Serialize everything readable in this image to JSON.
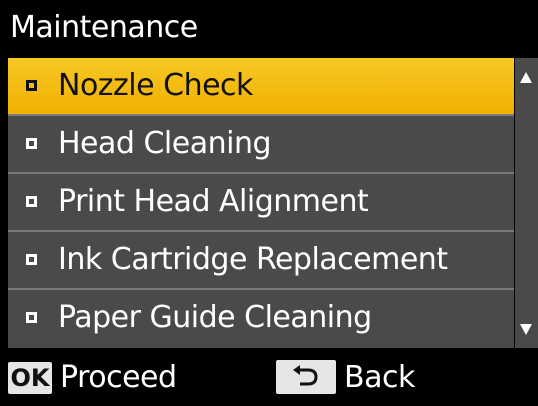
{
  "title": "Maintenance",
  "menu": {
    "items": [
      {
        "label": "Nozzle Check",
        "selected": true
      },
      {
        "label": "Head Cleaning",
        "selected": false
      },
      {
        "label": "Print Head Alignment",
        "selected": false
      },
      {
        "label": "Ink Cartridge Replacement",
        "selected": false
      },
      {
        "label": "Paper Guide Cleaning",
        "selected": false
      }
    ]
  },
  "footer": {
    "ok_key": "OK",
    "proceed_label": "Proceed",
    "back_label": "Back"
  },
  "colors": {
    "background": "#000000",
    "list_background": "#4a4a4a",
    "selected_highlight": "#f7c825",
    "text": "#ffffff",
    "key_background": "#e6e6e6"
  },
  "icons": {
    "scroll_up": "triangle-up-icon",
    "scroll_down": "triangle-down-icon",
    "back": "return-arrow-icon",
    "bullet": "square-bullet-icon"
  }
}
